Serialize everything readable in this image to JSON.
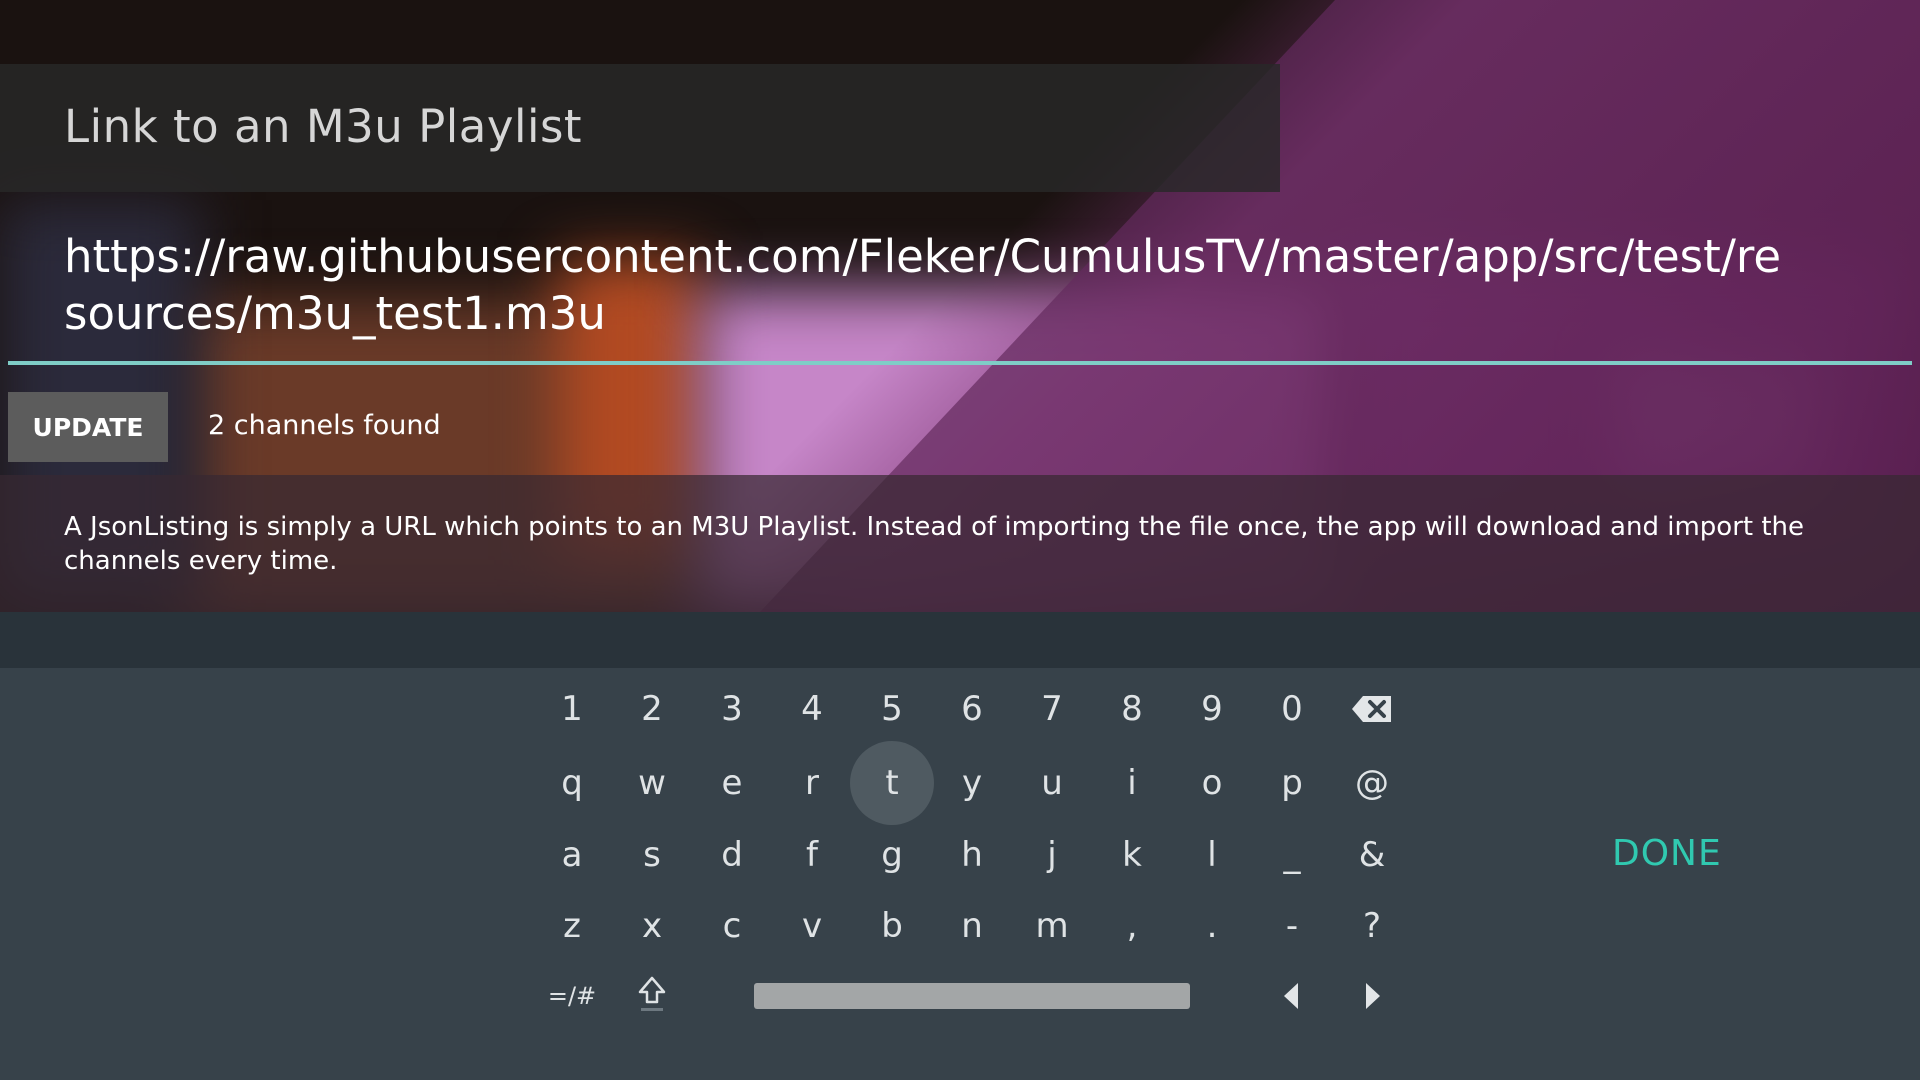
{
  "dialog": {
    "title": "Link to an M3u Playlist",
    "url_value": "https://raw.githubusercontent.com/Fleker/CumulusTV/master/app/src/test/resources/m3u_test1.m3u",
    "update_label": "UPDATE",
    "status": "2 channels found",
    "description": "A JsonListing is simply a URL which points to an M3U Playlist. Instead of importing the file once, the app will download and import the channels every time."
  },
  "keyboard": {
    "row1": [
      "1",
      "2",
      "3",
      "4",
      "5",
      "6",
      "7",
      "8",
      "9",
      "0"
    ],
    "row2": [
      "q",
      "w",
      "e",
      "r",
      "t",
      "y",
      "u",
      "i",
      "o",
      "p",
      "@"
    ],
    "row3": [
      "a",
      "s",
      "d",
      "f",
      "g",
      "h",
      "j",
      "k",
      "l",
      "_",
      "&"
    ],
    "row4": [
      "z",
      "x",
      "c",
      "v",
      "b",
      "n",
      "m",
      ",",
      ".",
      "-",
      "?"
    ],
    "symbols_label": "=/#",
    "done_label": "DONE",
    "focused_key": "t",
    "accent_color": "#30c9b0"
  }
}
